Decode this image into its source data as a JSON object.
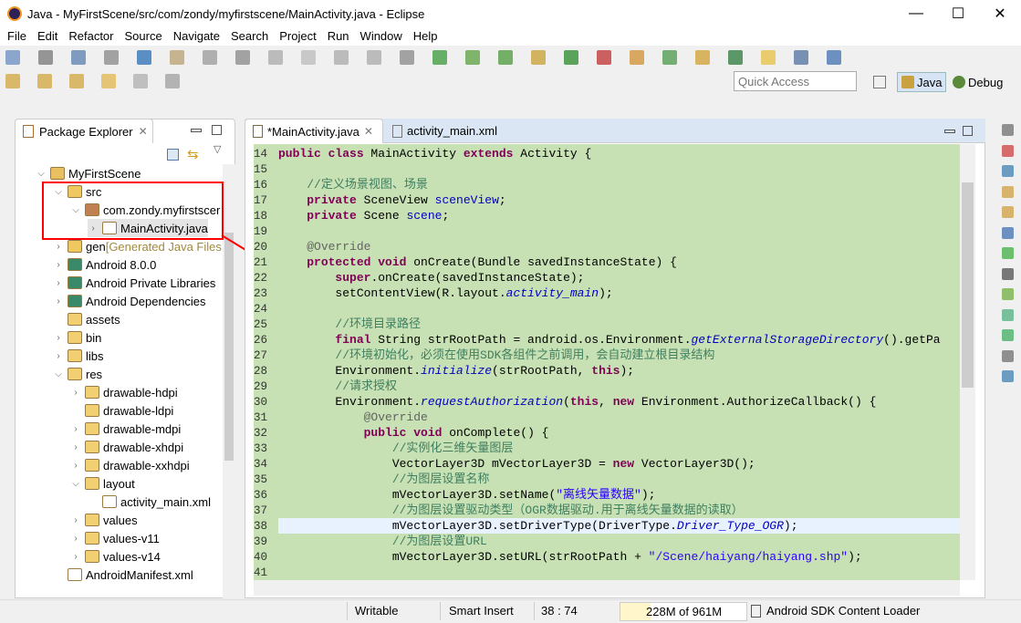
{
  "window": {
    "title": "Java - MyFirstScene/src/com/zondy/myfirstscene/MainActivity.java - Eclipse",
    "minimize": "—",
    "maximize": "☐",
    "close": "✕"
  },
  "menu": [
    "File",
    "Edit",
    "Refactor",
    "Source",
    "Navigate",
    "Search",
    "Project",
    "Run",
    "Window",
    "Help"
  ],
  "toolbar": {
    "quick_access_placeholder": "Quick Access",
    "perspectives": [
      {
        "label": "Java",
        "active": true
      },
      {
        "label": "Debug",
        "active": false
      }
    ]
  },
  "package_explorer": {
    "title": "Package Explorer",
    "tree": [
      {
        "label": "MyFirstScene",
        "depth": 0,
        "expanded": true,
        "icon": "project-icon"
      },
      {
        "label": "src",
        "depth": 1,
        "expanded": true,
        "icon": "source-folder-icon"
      },
      {
        "label": "com.zondy.myfirstscer",
        "depth": 2,
        "expanded": true,
        "icon": "package-icon"
      },
      {
        "label": "MainActivity.java",
        "depth": 3,
        "expanded": false,
        "icon": "java-file-icon",
        "selected": true
      },
      {
        "label": "gen",
        "suffix": " [Generated Java Files",
        "depth": 1,
        "expanded": false,
        "icon": "source-folder-icon"
      },
      {
        "label": "Android 8.0.0",
        "depth": 1,
        "expanded": false,
        "icon": "library-icon"
      },
      {
        "label": "Android Private Libraries",
        "depth": 1,
        "expanded": false,
        "icon": "library-icon"
      },
      {
        "label": "Android Dependencies",
        "depth": 1,
        "expanded": false,
        "icon": "library-icon"
      },
      {
        "label": "assets",
        "depth": 1,
        "leaf": true,
        "icon": "folder-icon"
      },
      {
        "label": "bin",
        "depth": 1,
        "expanded": false,
        "icon": "folder-icon"
      },
      {
        "label": "libs",
        "depth": 1,
        "expanded": false,
        "icon": "folder-icon"
      },
      {
        "label": "res",
        "depth": 1,
        "expanded": true,
        "icon": "folder-icon"
      },
      {
        "label": "drawable-hdpi",
        "depth": 2,
        "expanded": false,
        "icon": "folder-icon"
      },
      {
        "label": "drawable-ldpi",
        "depth": 2,
        "leaf": true,
        "icon": "folder-icon"
      },
      {
        "label": "drawable-mdpi",
        "depth": 2,
        "expanded": false,
        "icon": "folder-icon"
      },
      {
        "label": "drawable-xhdpi",
        "depth": 2,
        "expanded": false,
        "icon": "folder-icon"
      },
      {
        "label": "drawable-xxhdpi",
        "depth": 2,
        "expanded": false,
        "icon": "folder-icon"
      },
      {
        "label": "layout",
        "depth": 2,
        "expanded": true,
        "icon": "folder-icon"
      },
      {
        "label": "activity_main.xml",
        "depth": 3,
        "leaf": true,
        "icon": "xml-file-icon"
      },
      {
        "label": "values",
        "depth": 2,
        "expanded": false,
        "icon": "folder-icon"
      },
      {
        "label": "values-v11",
        "depth": 2,
        "expanded": false,
        "icon": "folder-icon"
      },
      {
        "label": "values-v14",
        "depth": 2,
        "expanded": false,
        "icon": "folder-icon"
      },
      {
        "label": "AndroidManifest.xml",
        "depth": 1,
        "leaf": true,
        "icon": "xml-file-icon"
      }
    ]
  },
  "editor": {
    "tabs": [
      {
        "label": "*MainActivity.java",
        "active": true
      },
      {
        "label": "activity_main.xml",
        "active": false
      }
    ],
    "current_line": 38,
    "lines": [
      {
        "n": "14",
        "t": [
          [
            "kw",
            "public class "
          ],
          [
            "",
            "MainActivity "
          ],
          [
            "kw",
            "extends "
          ],
          [
            "",
            "Activity {"
          ]
        ]
      },
      {
        "n": "15",
        "t": []
      },
      {
        "n": "16",
        "t": [
          [
            "",
            "    "
          ],
          [
            "cm",
            "//定义场景视图、场景"
          ]
        ]
      },
      {
        "n": "17",
        "t": [
          [
            "",
            "    "
          ],
          [
            "kw",
            "private "
          ],
          [
            "",
            "SceneView "
          ],
          [
            "fld",
            "sceneView"
          ],
          [
            "",
            ";"
          ]
        ]
      },
      {
        "n": "18",
        "t": [
          [
            "",
            "    "
          ],
          [
            "kw",
            "private "
          ],
          [
            "",
            "Scene "
          ],
          [
            "fld",
            "scene"
          ],
          [
            "",
            ";"
          ]
        ]
      },
      {
        "n": "19",
        "t": []
      },
      {
        "n": "20",
        "t": [
          [
            "",
            "    "
          ],
          [
            "ann",
            "@Override"
          ]
        ]
      },
      {
        "n": "21",
        "t": [
          [
            "",
            "    "
          ],
          [
            "kw",
            "protected void "
          ],
          [
            "",
            "onCreate(Bundle savedInstanceState) {"
          ]
        ]
      },
      {
        "n": "22",
        "t": [
          [
            "",
            "        "
          ],
          [
            "kw",
            "super"
          ],
          [
            "",
            ".onCreate(savedInstanceState);"
          ]
        ]
      },
      {
        "n": "23",
        "t": [
          [
            "",
            "        setContentView(R.layout."
          ],
          [
            "it",
            "activity_main"
          ],
          [
            "",
            ");"
          ]
        ]
      },
      {
        "n": "24",
        "t": []
      },
      {
        "n": "25",
        "t": [
          [
            "",
            "        "
          ],
          [
            "cm",
            "//环境目录路径"
          ]
        ]
      },
      {
        "n": "26",
        "t": [
          [
            "",
            "        "
          ],
          [
            "kw",
            "final "
          ],
          [
            "",
            "String strRootPath = android.os.Environment."
          ],
          [
            "it",
            "getExternalStorageDirectory"
          ],
          [
            "",
            "().getPa"
          ]
        ]
      },
      {
        "n": "27",
        "t": [
          [
            "",
            "        "
          ],
          [
            "cm",
            "//环境初始化，必须在使用SDK各组件之前调用，会自动建立根目录结构"
          ]
        ]
      },
      {
        "n": "28",
        "t": [
          [
            "",
            "        Environment."
          ],
          [
            "it",
            "initialize"
          ],
          [
            "",
            "(strRootPath, "
          ],
          [
            "kw",
            "this"
          ],
          [
            "",
            ");"
          ]
        ]
      },
      {
        "n": "29",
        "t": [
          [
            "",
            "        "
          ],
          [
            "cm",
            "//请求授权"
          ]
        ]
      },
      {
        "n": "30",
        "t": [
          [
            "",
            "        Environment."
          ],
          [
            "it",
            "requestAuthorization"
          ],
          [
            "",
            "("
          ],
          [
            "kw",
            "this"
          ],
          [
            "",
            ", "
          ],
          [
            "kw",
            "new "
          ],
          [
            "",
            "Environment.AuthorizeCallback() {"
          ]
        ]
      },
      {
        "n": "31",
        "t": [
          [
            "",
            "            "
          ],
          [
            "ann",
            "@Override"
          ]
        ]
      },
      {
        "n": "32",
        "t": [
          [
            "",
            "            "
          ],
          [
            "kw",
            "public void "
          ],
          [
            "",
            "onComplete() {"
          ]
        ]
      },
      {
        "n": "33",
        "t": [
          [
            "",
            "                "
          ],
          [
            "cm",
            "//实例化三维矢量图层"
          ]
        ]
      },
      {
        "n": "34",
        "t": [
          [
            "",
            "                VectorLayer3D mVectorLayer3D = "
          ],
          [
            "kw",
            "new "
          ],
          [
            "",
            "VectorLayer3D();"
          ]
        ]
      },
      {
        "n": "35",
        "t": [
          [
            "",
            "                "
          ],
          [
            "cm",
            "//为图层设置名称"
          ]
        ]
      },
      {
        "n": "36",
        "t": [
          [
            "",
            "                mVectorLayer3D.setName("
          ],
          [
            "str",
            "\"离线矢量数据\""
          ],
          [
            "",
            ");"
          ]
        ]
      },
      {
        "n": "37",
        "t": [
          [
            "",
            "                "
          ],
          [
            "cm",
            "//为图层设置驱动类型（OGR数据驱动.用于离线矢量数据的读取）"
          ]
        ]
      },
      {
        "n": "38",
        "t": [
          [
            "",
            "                mVectorLayer3D.setDriverType(DriverType."
          ],
          [
            "it",
            "Driver_Type_OGR"
          ],
          [
            "",
            ");"
          ]
        ]
      },
      {
        "n": "39",
        "t": [
          [
            "",
            "                "
          ],
          [
            "cm",
            "//为图层设置URL"
          ]
        ]
      },
      {
        "n": "40",
        "t": [
          [
            "",
            "                mVectorLayer3D.setURL(strRootPath + "
          ],
          [
            "str",
            "\"/Scene/haiyang/haiyang.shp\""
          ],
          [
            "",
            ");"
          ]
        ]
      },
      {
        "n": "41",
        "t": []
      }
    ]
  },
  "status": {
    "mode": "Writable",
    "insert": "Smart Insert",
    "position": "38 : 74",
    "heap": "228M of 961M",
    "heap_used_percent": 23.7,
    "task": "Android SDK Content Loader"
  },
  "colors": {
    "editor_bg": "#c7e0b4",
    "highlight_box": "#ff0000",
    "keyword": "#7f0055",
    "comment": "#3f7f5f"
  }
}
